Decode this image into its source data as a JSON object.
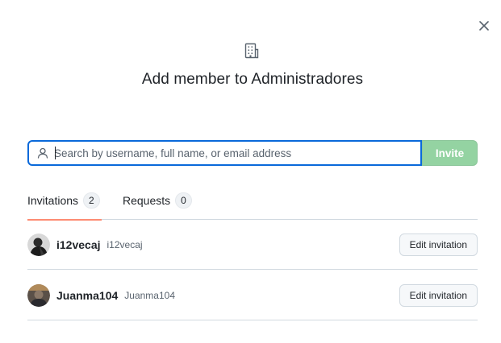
{
  "dialog": {
    "title": "Add member to Administradores",
    "close_icon": "close-icon",
    "org_icon": "organization-icon"
  },
  "search": {
    "placeholder": "Search by username, full name, or email address",
    "value": "",
    "icon": "person-icon"
  },
  "invite_button": {
    "label": "Invite",
    "color": "#94d3a2"
  },
  "tabs": [
    {
      "label": "Invitations",
      "count": "2",
      "active": true
    },
    {
      "label": "Requests",
      "count": "0",
      "active": false
    }
  ],
  "invitations": [
    {
      "username": "i12vecaj",
      "fullname": "i12vecaj",
      "action": "Edit invitation"
    },
    {
      "username": "Juanma104",
      "fullname": "Juanma104",
      "action": "Edit invitation"
    }
  ],
  "colors": {
    "focus_border": "#0969da",
    "tab_underline": "#d0703c",
    "divider": "#d1d9e0"
  }
}
